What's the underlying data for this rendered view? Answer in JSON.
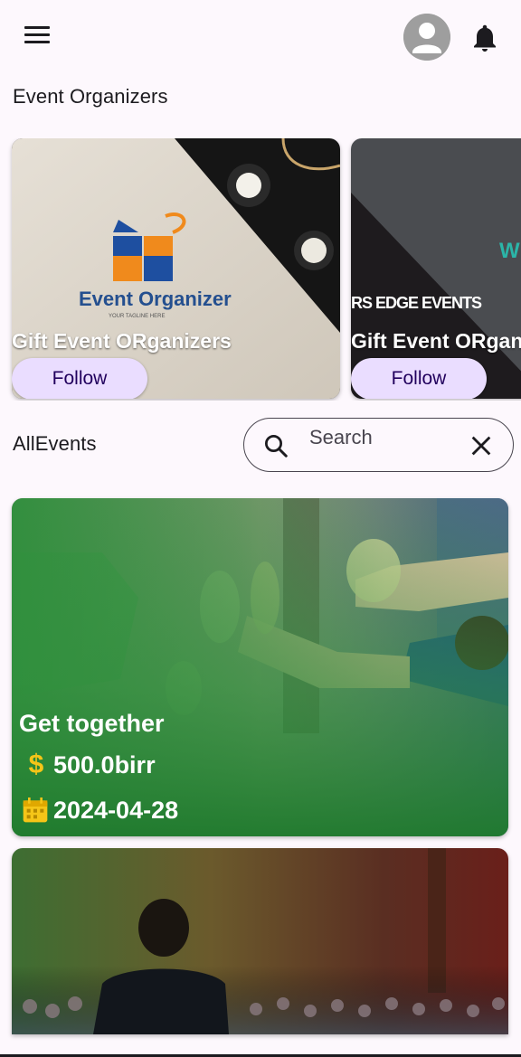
{
  "header": {
    "menu_icon": "menu-icon",
    "avatar_icon": "account-circle-icon",
    "notification_icon": "bell-icon"
  },
  "organizers": {
    "title": "Event Organizers",
    "items": [
      {
        "name": "Gift Event ORganizers",
        "follow_label": "Follow",
        "logo_text": "Event Organizer",
        "logo_tagline": "YOUR TAGLINE HERE"
      },
      {
        "name": "Gift Event ORganizers",
        "follow_label": "Follow",
        "banner_text": "RS EDGE EVENTS"
      }
    ]
  },
  "events": {
    "title": "AllEvents",
    "search": {
      "placeholder": "Search",
      "value": ""
    },
    "items": [
      {
        "title": "Get together",
        "price": "500.0birr",
        "date": "2024-04-28"
      },
      {
        "title": "",
        "price": "",
        "date": ""
      }
    ]
  },
  "colors": {
    "background": "#fdf8fd",
    "follow_button": "#eaddff",
    "accent_gold": "#f5c518",
    "overlay_green": "#2e8b3a"
  }
}
